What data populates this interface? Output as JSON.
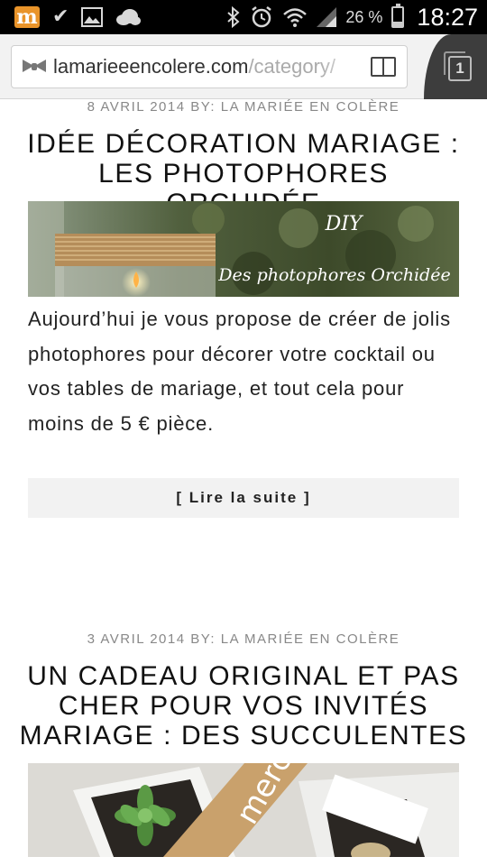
{
  "status_bar": {
    "notification_icons": [
      "m-app-icon",
      "check-icon",
      "image-icon",
      "cloud-icon"
    ],
    "system_icons": [
      "bluetooth-icon",
      "alarm-icon",
      "wifi-icon",
      "signal-icon",
      "battery-icon"
    ],
    "battery_percent": "26 %",
    "battery_level": 0.26,
    "time": "18:27"
  },
  "browser": {
    "url_domain": "lamarieeencolere.com",
    "url_path": "/category/",
    "tab_count": "1"
  },
  "posts": [
    {
      "meta": "8 avril 2014 By: La Mariée en Colère",
      "title": "Idée décoration mariage : les photophores orchidée",
      "image_overlay_line1": "DIY",
      "image_overlay_line2": "Des photophores Orchidée",
      "excerpt": "Aujourd’hui je vous propose de créer de jolis photophores pour décorer votre cocktail ou vos tables de mariage, et tout cela pour moins de 5 € pièce.",
      "read_more": "[ Lire la suite ]"
    },
    {
      "meta": "3 avril 2014 By: La Mariée en Colère",
      "title": "Un cadeau original et pas cher pour vos invités mariage : des succulentes",
      "image_tag_text": "merci"
    }
  ]
}
